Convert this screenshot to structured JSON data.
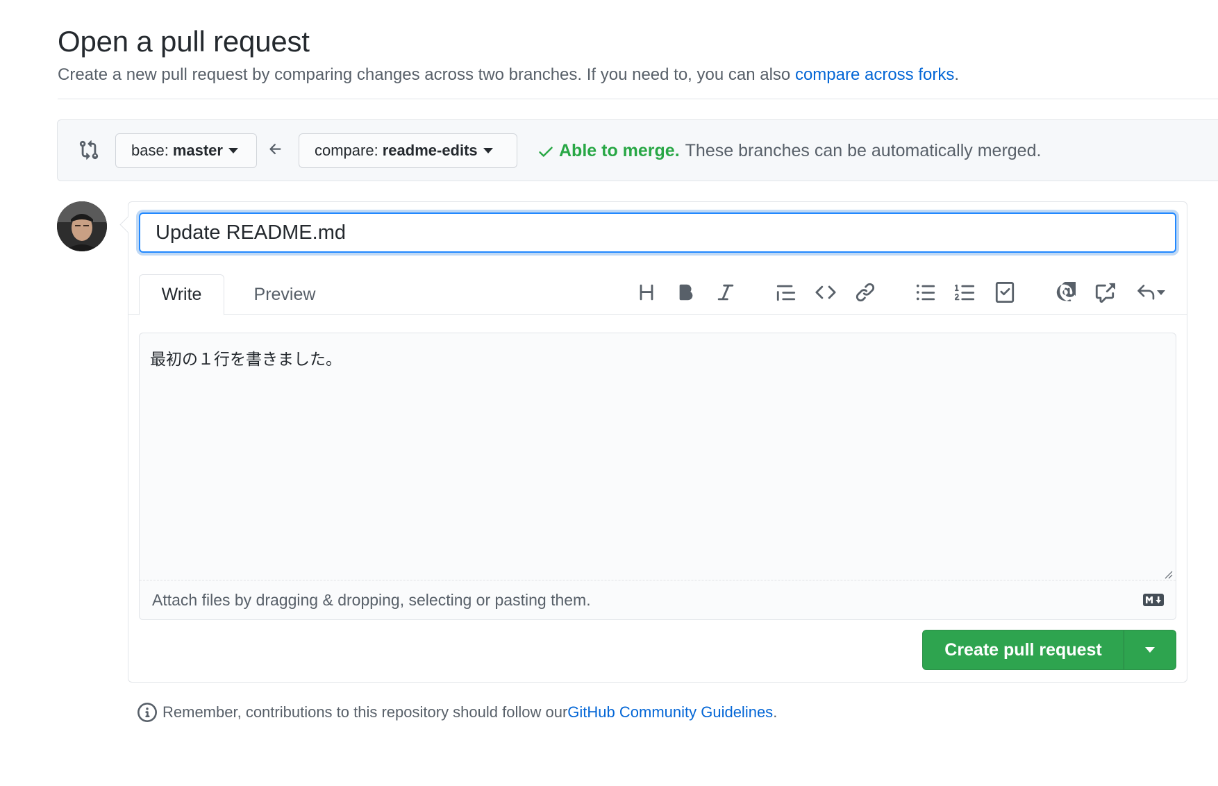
{
  "header": {
    "title": "Open a pull request",
    "subtitle_text": "Create a new pull request by comparing changes across two branches. If you need to, you can also ",
    "subtitle_link": "compare across forks",
    "subtitle_end": "."
  },
  "range": {
    "base_prefix": "base:",
    "base_branch": "master",
    "compare_prefix": "compare:",
    "compare_branch": "readme-edits",
    "merge_ok": "Able to merge.",
    "merge_detail": "These branches can be automatically merged."
  },
  "form": {
    "title_value": "Update README.md",
    "tabs": {
      "write": "Write",
      "preview": "Preview"
    },
    "body_value": "最初の１行を書きました。",
    "drop_hint": "Attach files by dragging & dropping, selecting or pasting them.",
    "submit_label": "Create pull request"
  },
  "footer": {
    "text": "Remember, contributions to this repository should follow our ",
    "link": "GitHub Community Guidelines",
    "end": "."
  },
  "toolbar_icons": [
    "heading-icon",
    "bold-icon",
    "italic-icon",
    "quote-icon",
    "code-icon",
    "link-icon",
    "bulleted-list-icon",
    "numbered-list-icon",
    "task-list-icon",
    "mention-icon",
    "cross-reference-icon",
    "reply-icon"
  ],
  "colors": {
    "accent": "#0366d6",
    "success": "#28a745",
    "button_green": "#2ea44f"
  }
}
